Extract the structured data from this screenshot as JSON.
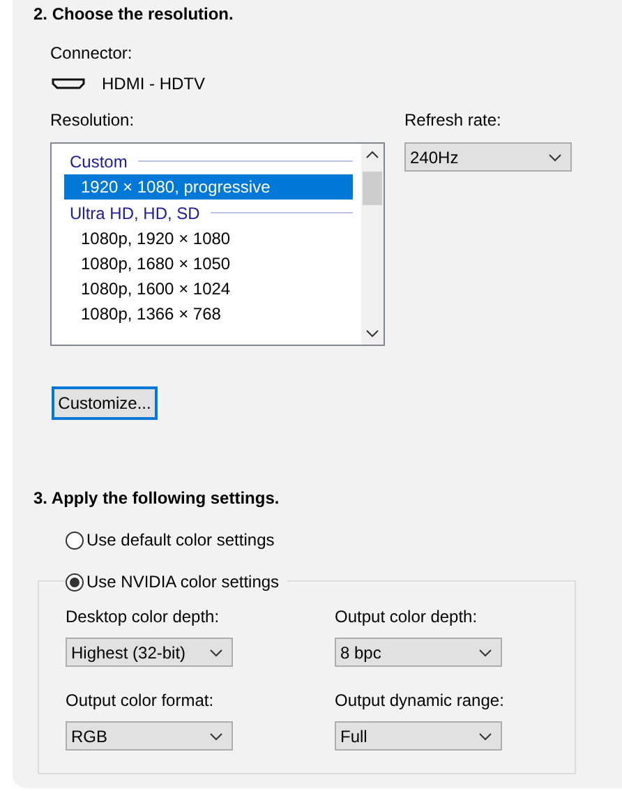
{
  "section_2": {
    "heading": "2. Choose the resolution.",
    "connector_label": "Connector:",
    "connector": "HDMI - HDTV",
    "resolution_label": "Resolution:",
    "resolution_list": [
      {
        "kind": "group",
        "label": "Custom"
      },
      {
        "kind": "item",
        "label": "1920 × 1080, progressive",
        "selected": true
      },
      {
        "kind": "group",
        "label": "Ultra HD, HD, SD"
      },
      {
        "kind": "item",
        "label": "1080p, 1920 × 1080",
        "selected": false
      },
      {
        "kind": "item",
        "label": "1080p, 1680 × 1050",
        "selected": false
      },
      {
        "kind": "item",
        "label": "1080p, 1600 × 1024",
        "selected": false
      },
      {
        "kind": "item",
        "label": "1080p, 1366 × 768",
        "selected": false
      }
    ],
    "refresh_label": "Refresh rate:",
    "refresh_value": "240Hz",
    "customize_button": "Customize..."
  },
  "section_3": {
    "heading": "3. Apply the following settings.",
    "options": [
      {
        "label": "Use default color settings",
        "selected": false
      },
      {
        "label": "Use NVIDIA color settings",
        "selected": true
      }
    ],
    "fields": [
      {
        "label": "Desktop color depth:",
        "value": "Highest (32-bit)"
      },
      {
        "label": "Output color depth:",
        "value": "8 bpc"
      },
      {
        "label": "Output color format:",
        "value": "RGB"
      },
      {
        "label": "Output dynamic range:",
        "value": "Full"
      }
    ]
  }
}
